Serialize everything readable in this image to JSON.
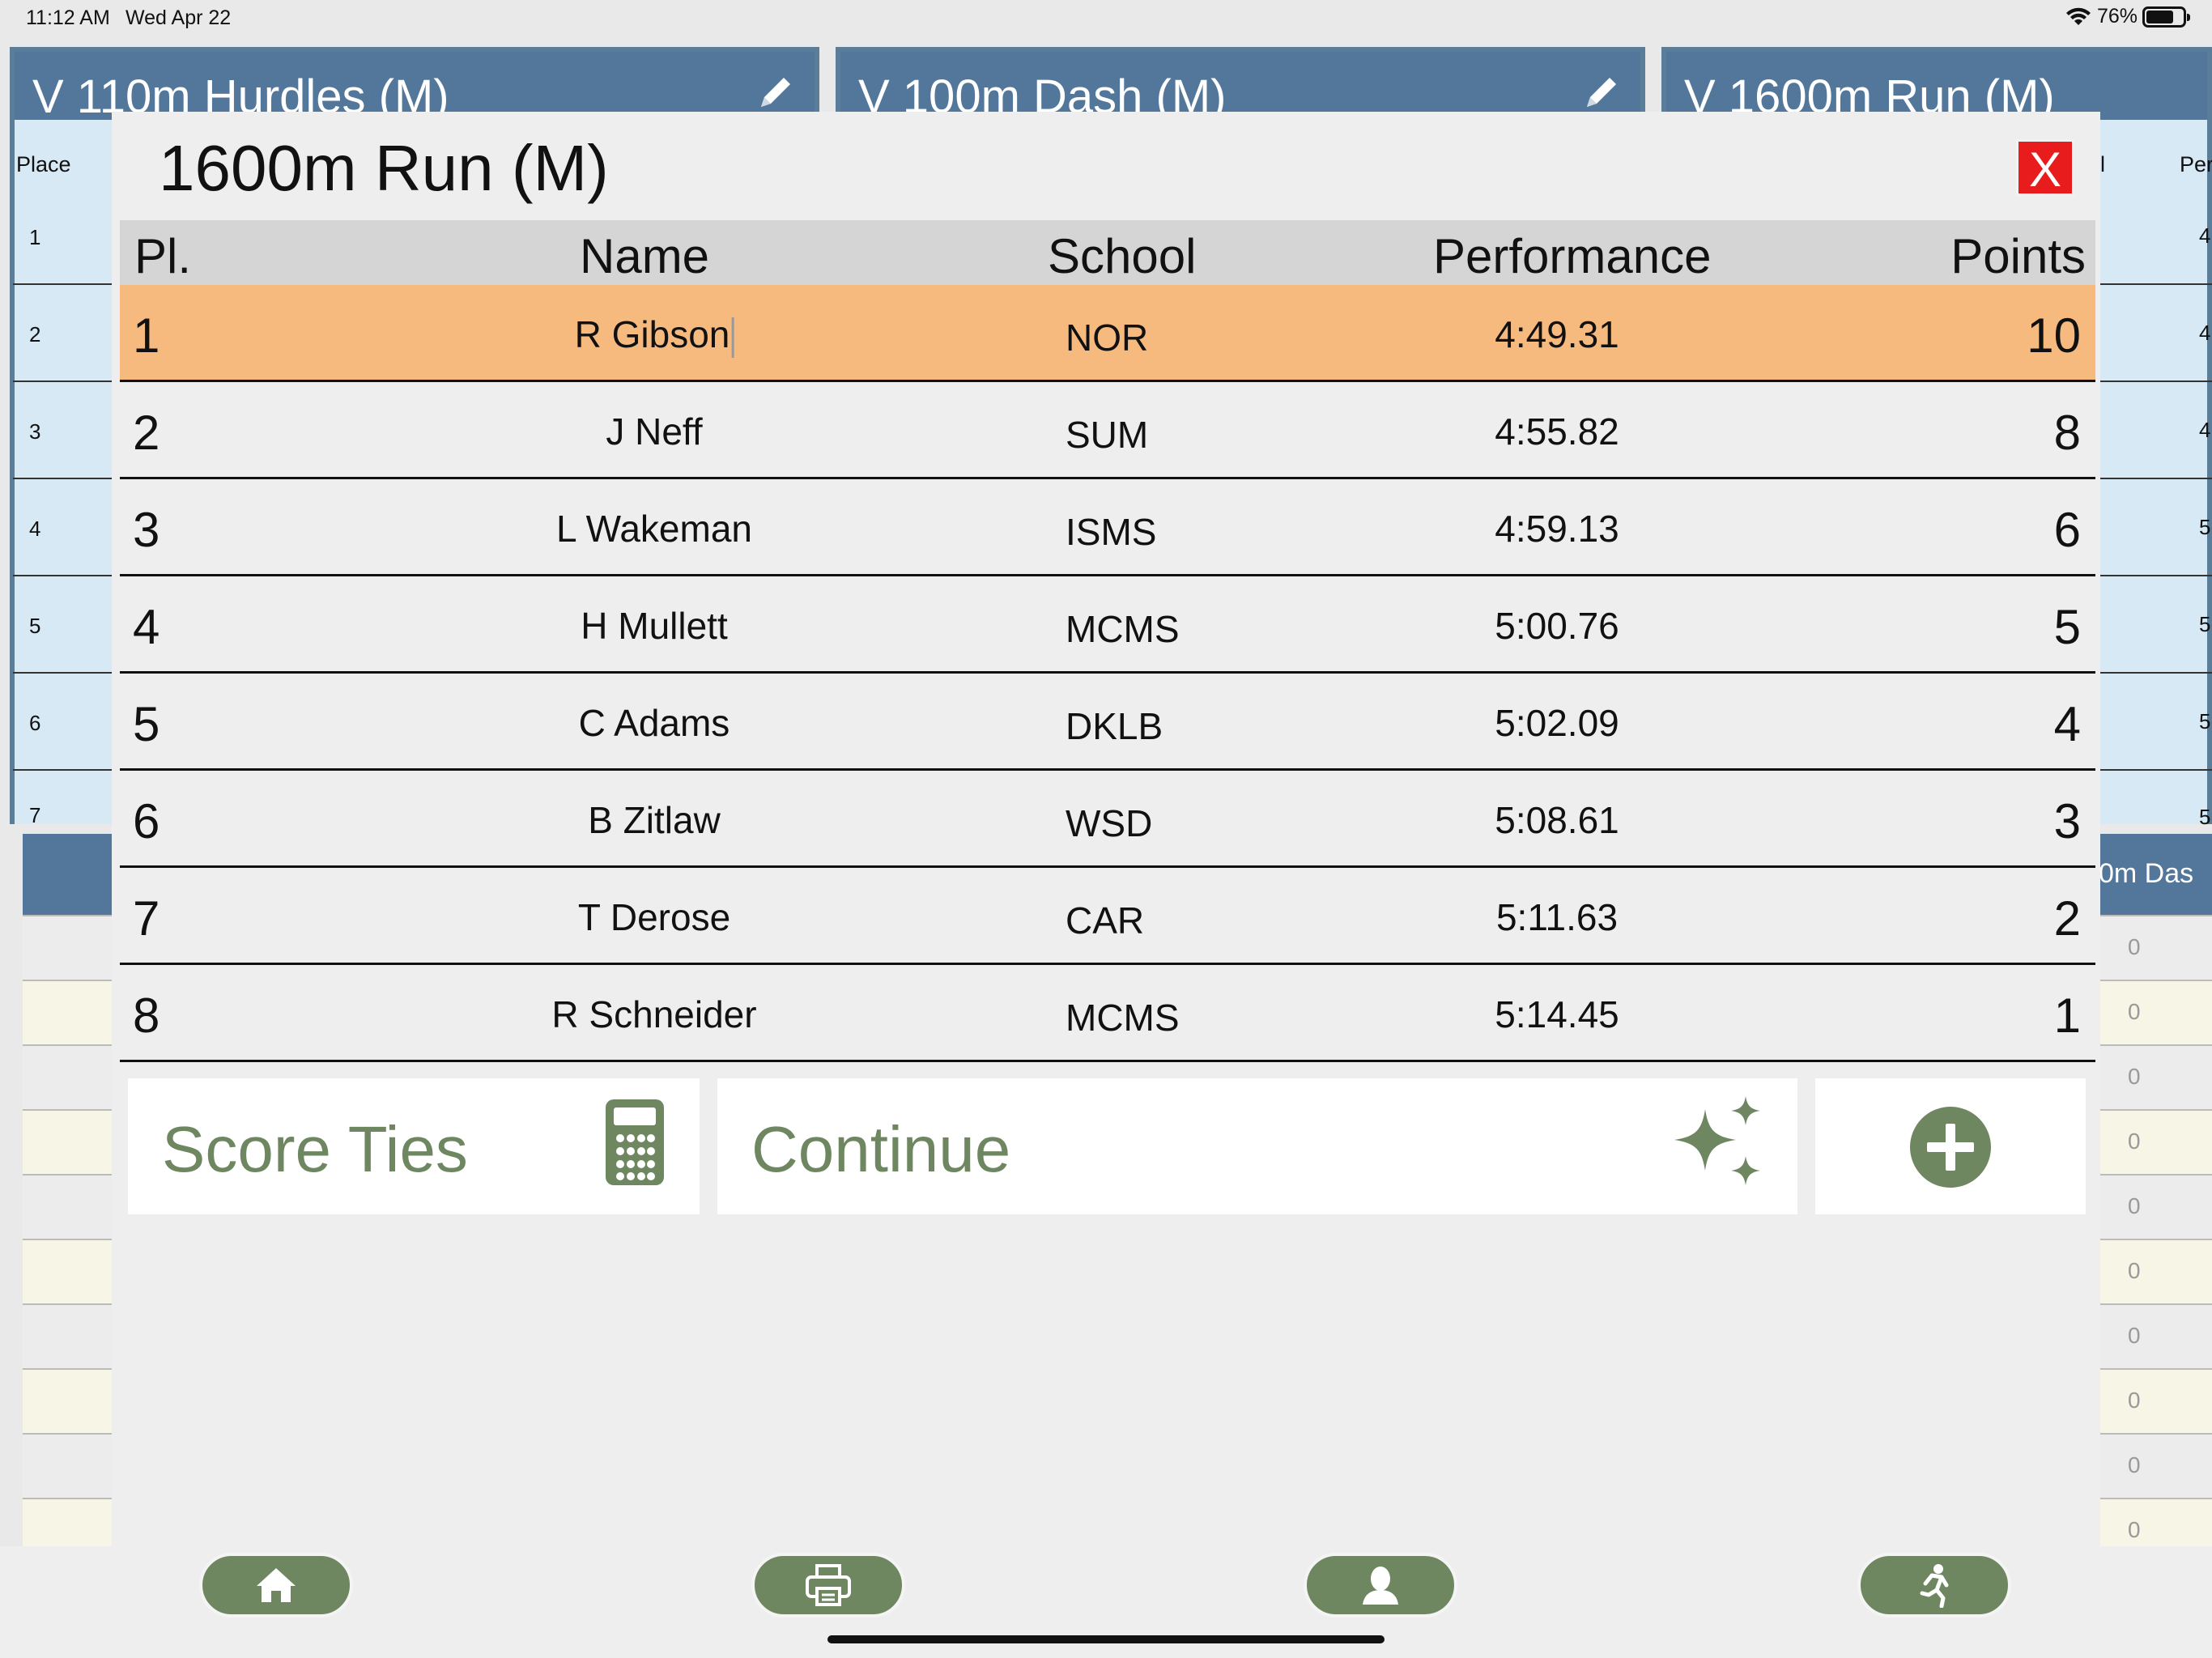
{
  "status_bar": {
    "time": "11:12 AM",
    "date": "Wed Apr 22",
    "battery": "76%"
  },
  "background": {
    "cards": [
      {
        "title": "V 110m Hurdles (M)"
      },
      {
        "title": "V 100m Dash (M)"
      },
      {
        "title": "V 1600m Run (M)"
      }
    ],
    "place_header": "Place",
    "places": [
      "1",
      "2",
      "3",
      "4",
      "5",
      "6",
      "7"
    ],
    "right_header_partial": "Per",
    "right_letter_partial": "l",
    "right_values_partial": [
      "4",
      "4",
      "4",
      "5",
      "5",
      "5",
      "5"
    ],
    "lower_header_partial": "0m Das",
    "lower_values": [
      "0",
      "0",
      "0",
      "0",
      "0",
      "0",
      "0",
      "0",
      "0",
      "0"
    ]
  },
  "modal": {
    "title": "1600m Run (M)",
    "close_label": "X",
    "columns": {
      "place": "Pl.",
      "name": "Name",
      "school": "School",
      "performance": "Performance",
      "points": "Points"
    },
    "rows": [
      {
        "place": "1",
        "name": "R Gibson",
        "school": "NOR",
        "performance": "4:49.31",
        "points": "10"
      },
      {
        "place": "2",
        "name": "J Neff",
        "school": "SUM",
        "performance": "4:55.82",
        "points": "8"
      },
      {
        "place": "3",
        "name": "L Wakeman",
        "school": "ISMS",
        "performance": "4:59.13",
        "points": "6"
      },
      {
        "place": "4",
        "name": "H Mullett",
        "school": "MCMS",
        "performance": "5:00.76",
        "points": "5"
      },
      {
        "place": "5",
        "name": "C Adams",
        "school": "DKLB",
        "performance": "5:02.09",
        "points": "4"
      },
      {
        "place": "6",
        "name": "B Zitlaw",
        "school": "WSD",
        "performance": "5:08.61",
        "points": "3"
      },
      {
        "place": "7",
        "name": "T Derose",
        "school": "CAR",
        "performance": "5:11.63",
        "points": "2"
      },
      {
        "place": "8",
        "name": "R Schneider",
        "school": "MCMS",
        "performance": "5:14.45",
        "points": "1"
      }
    ],
    "score_ties_label": "Score Ties",
    "continue_label": "Continue"
  },
  "colors": {
    "header_blue": "#53779a",
    "accent_green": "#6e8760",
    "highlight_orange": "#f6ba7f",
    "close_red": "#e81c1c"
  },
  "toolbar": {
    "icons": [
      "home-icon",
      "print-icon",
      "person-icon",
      "runner-icon"
    ]
  }
}
